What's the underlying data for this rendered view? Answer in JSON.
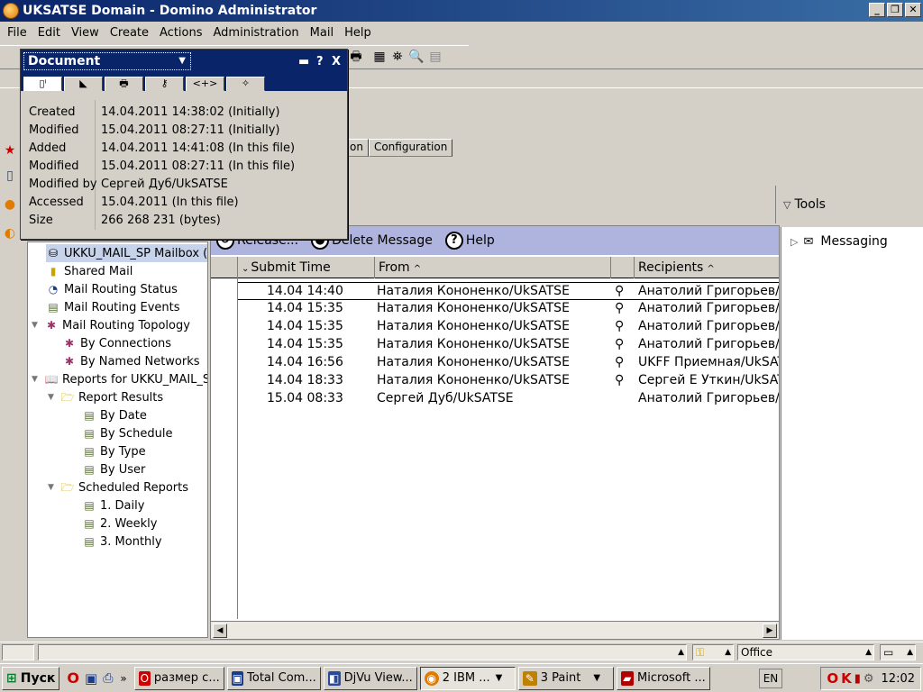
{
  "window": {
    "title": "UKSATSE Domain - Domino Administrator"
  },
  "menu": [
    "File",
    "Edit",
    "View",
    "Create",
    "Actions",
    "Administration",
    "Mail",
    "Help"
  ],
  "tabs": [
    "cation",
    "Configuration"
  ],
  "tools": {
    "label": "Tools"
  },
  "doc_props": {
    "selector": "Document",
    "controls": {
      "help": "?",
      "close": "X"
    },
    "tab_icons": [
      "page-icon",
      "field-icon",
      "print-icon",
      "key-icon",
      "code-icon",
      "spirit-icon"
    ],
    "rows": [
      {
        "key": "Created",
        "value": "14.04.2011 14:38:02 (Initially)"
      },
      {
        "key": "Modified",
        "value": "15.04.2011 08:27:11 (Initially)"
      },
      {
        "key": "Added",
        "value": "14.04.2011 14:41:08 (In this file)"
      },
      {
        "key": "Modified",
        "value": "15.04.2011 08:27:11 (In this file)"
      },
      {
        "key": "Modified by",
        "value": "Сергей Дуб/UkSATSE"
      },
      {
        "key": "Accessed",
        "value": "15.04.2011 (In this file)"
      },
      {
        "key": "Size",
        "value": "266 268 231 (bytes)"
      }
    ]
  },
  "nav": [
    {
      "label": "UKKU_MAIL_SP Mailbox (",
      "icon": "mailbox-icon",
      "selected": true
    },
    {
      "label": "Shared Mail",
      "icon": "shared-mail-icon"
    },
    {
      "label": "Mail Routing Status",
      "icon": "gauge-icon"
    },
    {
      "label": "Mail Routing Events",
      "icon": "list-icon"
    },
    {
      "label": "Mail Routing Topology",
      "icon": "topology-icon",
      "twisty": true
    },
    {
      "label": "By Connections",
      "icon": "topology-icon"
    },
    {
      "label": "By Named Networks",
      "icon": "topology-icon"
    },
    {
      "label": "Reports for UKKU_MAIL_S",
      "icon": "book-icon",
      "twisty": true
    },
    {
      "label": "Report Results",
      "icon": "folder-icon",
      "twisty": true
    },
    {
      "label": "By Date",
      "icon": "view-icon"
    },
    {
      "label": "By Schedule",
      "icon": "view-icon"
    },
    {
      "label": "By Type",
      "icon": "view-icon"
    },
    {
      "label": "By User",
      "icon": "view-icon"
    },
    {
      "label": "Scheduled Reports",
      "icon": "folder-icon",
      "twisty": true
    },
    {
      "label": "1. Daily",
      "icon": "view-icon"
    },
    {
      "label": "2. Weekly",
      "icon": "view-icon"
    },
    {
      "label": "3. Monthly",
      "icon": "view-icon"
    }
  ],
  "actions": {
    "release": "Release...",
    "delete": "Delete Message",
    "help": "Help"
  },
  "columns": {
    "submit": "Submit Time",
    "from": "From",
    "recipients": "Recipients"
  },
  "messages": [
    {
      "time": "14.04 14:40",
      "from": "Наталия Кононенко/UkSATSE",
      "attach": true,
      "to": "Анатолий Григорьев/U"
    },
    {
      "time": "14.04 15:35",
      "from": "Наталия Кононенко/UkSATSE",
      "attach": true,
      "to": "Анатолий Григорьев/U"
    },
    {
      "time": "14.04 15:35",
      "from": "Наталия Кононенко/UkSATSE",
      "attach": true,
      "to": "Анатолий Григорьев/U"
    },
    {
      "time": "14.04 15:35",
      "from": "Наталия Кононенко/UkSATSE",
      "attach": true,
      "to": "Анатолий Григорьев/U"
    },
    {
      "time": "14.04 16:56",
      "from": "Наталия Кононенко/UkSATSE",
      "attach": true,
      "to": "UKFF Приемная/UkSAT"
    },
    {
      "time": "14.04 18:33",
      "from": "Наталия Кононенко/UkSATSE",
      "attach": true,
      "to": "Сергей Е Уткин/UkSAT"
    },
    {
      "time": "15.04 08:33",
      "from": "Сергей Дуб/UkSATSE",
      "attach": false,
      "to": "Анатолий Григорьев/U"
    }
  ],
  "right_pane": {
    "messaging": "Messaging"
  },
  "status": {
    "location": "Office"
  },
  "taskbar": {
    "start": "Пуск",
    "tasks": [
      {
        "label": "размер с...",
        "color": "#cc0000"
      },
      {
        "label": "Total Com...",
        "color": "#1a3c8a"
      },
      {
        "label": "DjVu View...",
        "color": "#2a4a9a"
      },
      {
        "label": "2 IBM ...",
        "color": "#e07b00",
        "active": true
      },
      {
        "label": "3 Paint",
        "color": "#c08000"
      },
      {
        "label": "Microsoft ...",
        "color": "#b00000"
      }
    ],
    "lang": "EN",
    "clock": "12:02"
  }
}
